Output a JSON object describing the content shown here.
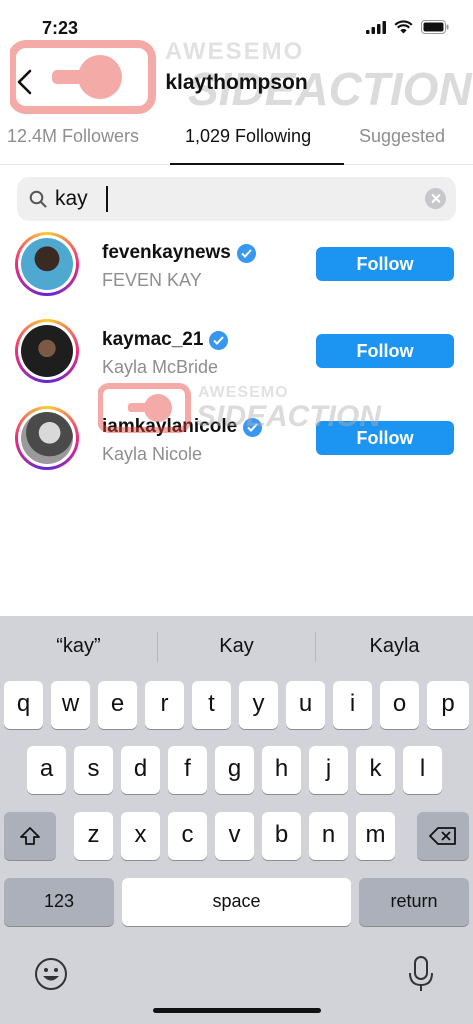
{
  "status": {
    "time": "7:23"
  },
  "header": {
    "title": "klaythompson",
    "back_icon": "chevron-left-icon"
  },
  "tabs": [
    {
      "label": "12.4M Followers"
    },
    {
      "label": "1,029 Following"
    },
    {
      "label": "Suggested"
    }
  ],
  "search": {
    "value": "kay",
    "icon": "search-icon"
  },
  "results": [
    {
      "username": "fevenkaynews",
      "name": "FEVEN KAY",
      "button": "Follow",
      "avatar_color": "#3a8fb7"
    },
    {
      "username": "kaymac_21",
      "name": "Kayla McBride",
      "button": "Follow",
      "avatar_color": "#2a2a2a"
    },
    {
      "username": "iamkaylanicole",
      "name": "Kayla Nicole",
      "button": "Follow",
      "avatar_color": "#6b6b6b"
    }
  ],
  "watermark": {
    "line1": "AWESEMO",
    "line2": "SIDEACTION"
  },
  "keyboard": {
    "suggestions": [
      "“kay”",
      "Kay",
      "Kayla"
    ],
    "row1": [
      "q",
      "w",
      "e",
      "r",
      "t",
      "y",
      "u",
      "i",
      "o",
      "p"
    ],
    "row2": [
      "a",
      "s",
      "d",
      "f",
      "g",
      "h",
      "j",
      "k",
      "l"
    ],
    "row3": [
      "z",
      "x",
      "c",
      "v",
      "b",
      "n",
      "m"
    ],
    "numbers": "123",
    "space": "space",
    "return": "return"
  },
  "colors": {
    "accent": "#1c95f2",
    "verified": "#3897f0",
    "watermark": "#e8473d"
  }
}
